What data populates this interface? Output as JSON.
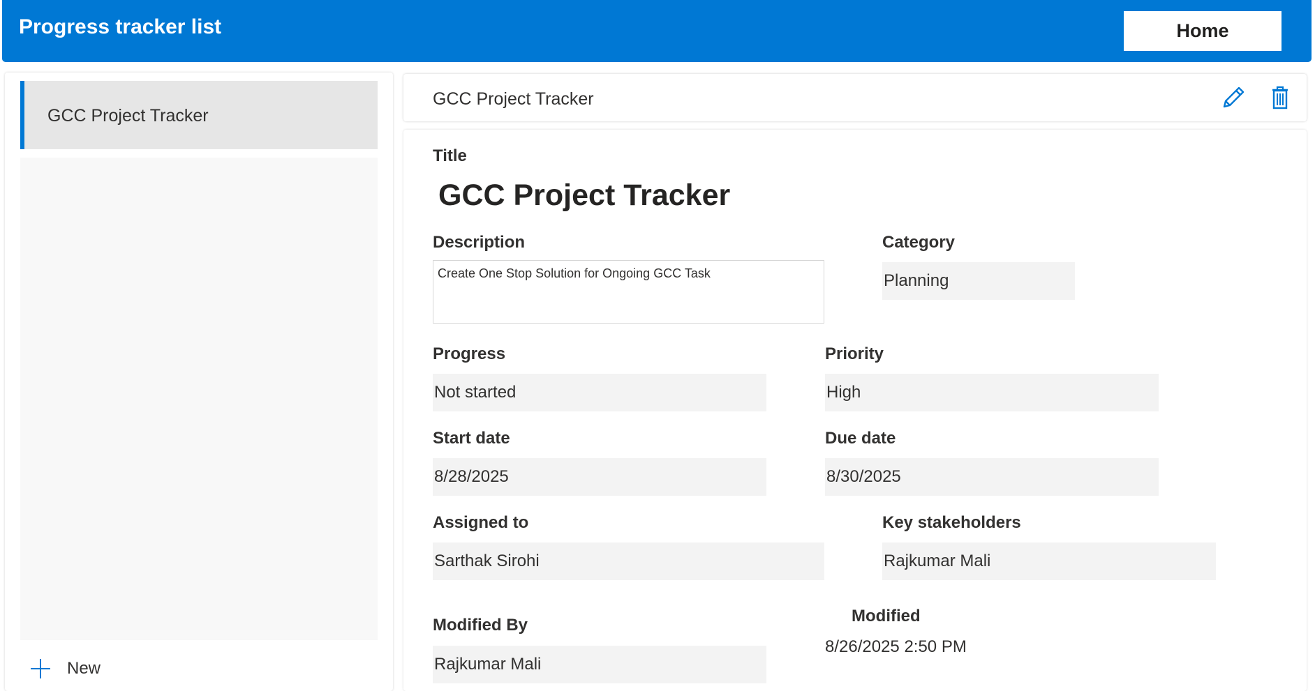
{
  "header": {
    "title": "Progress tracker list",
    "home_label": "Home"
  },
  "sidebar": {
    "items": [
      {
        "label": "GCC Project Tracker",
        "selected": true
      }
    ],
    "new_label": "New"
  },
  "detail": {
    "header_title": "GCC Project Tracker",
    "actions": {
      "edit_icon": "pencil-icon",
      "delete_icon": "trash-icon"
    },
    "fields": {
      "title_label": "Title",
      "title_value": "GCC Project Tracker",
      "description_label": "Description",
      "description_value": "Create One Stop Solution for Ongoing GCC Task",
      "category_label": "Category",
      "category_value": "Planning",
      "progress_label": "Progress",
      "progress_value": "Not started",
      "priority_label": "Priority",
      "priority_value": "High",
      "start_date_label": "Start date",
      "start_date_value": "8/28/2025",
      "due_date_label": "Due date",
      "due_date_value": "8/30/2025",
      "assigned_to_label": "Assigned to",
      "assigned_to_value": "Sarthak Sirohi",
      "stakeholders_label": "Key stakeholders",
      "stakeholders_value": "Rajkumar Mali",
      "modified_by_label": "Modified By",
      "modified_by_value": "Rajkumar Mali",
      "modified_label": "Modified",
      "modified_value": "8/26/2025 2:50 PM"
    }
  },
  "colors": {
    "brand": "#0078d4",
    "field_bg": "#f3f3f3",
    "selected_bg": "#e6e6e6"
  }
}
